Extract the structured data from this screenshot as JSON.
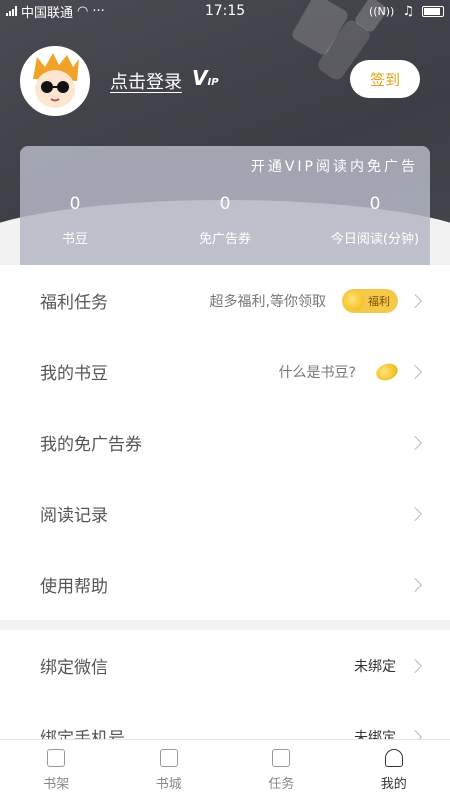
{
  "status_bar": {
    "carrier": "中国联通",
    "network": "4G",
    "time": "17:15",
    "dots": "···"
  },
  "profile": {
    "login_text": "点击登录",
    "vip_mark": "V",
    "vip_mark_small": "IP",
    "signin_label": "签到"
  },
  "vip_card": {
    "promo": "开通VIP阅读内免广告",
    "stats": [
      {
        "value": "0",
        "label": "书豆"
      },
      {
        "value": "0",
        "label": "免广告券"
      },
      {
        "value": "0",
        "label": "今日阅读(分钟)"
      }
    ]
  },
  "menu": [
    {
      "label": "福利任务",
      "hint": "超多福利,等你领取",
      "badge": "福利"
    },
    {
      "label": "我的书豆",
      "hint": "什么是书豆?"
    },
    {
      "label": "我的免广告券"
    },
    {
      "label": "阅读记录"
    },
    {
      "label": "使用帮助"
    }
  ],
  "bind_menu": [
    {
      "label": "绑定微信",
      "value": "未绑定"
    },
    {
      "label": "绑定手机号",
      "value": "未绑定"
    }
  ],
  "tabs": [
    {
      "label": "书架",
      "icon": "bookshelf-icon"
    },
    {
      "label": "书城",
      "icon": "bookstore-icon"
    },
    {
      "label": "任务",
      "icon": "task-icon"
    },
    {
      "label": "我的",
      "icon": "profile-icon",
      "active": true
    }
  ],
  "colors": {
    "header_bg": "#43444b",
    "accent_gold": "#e0a31a",
    "badge_bg": "#f6c84a"
  }
}
